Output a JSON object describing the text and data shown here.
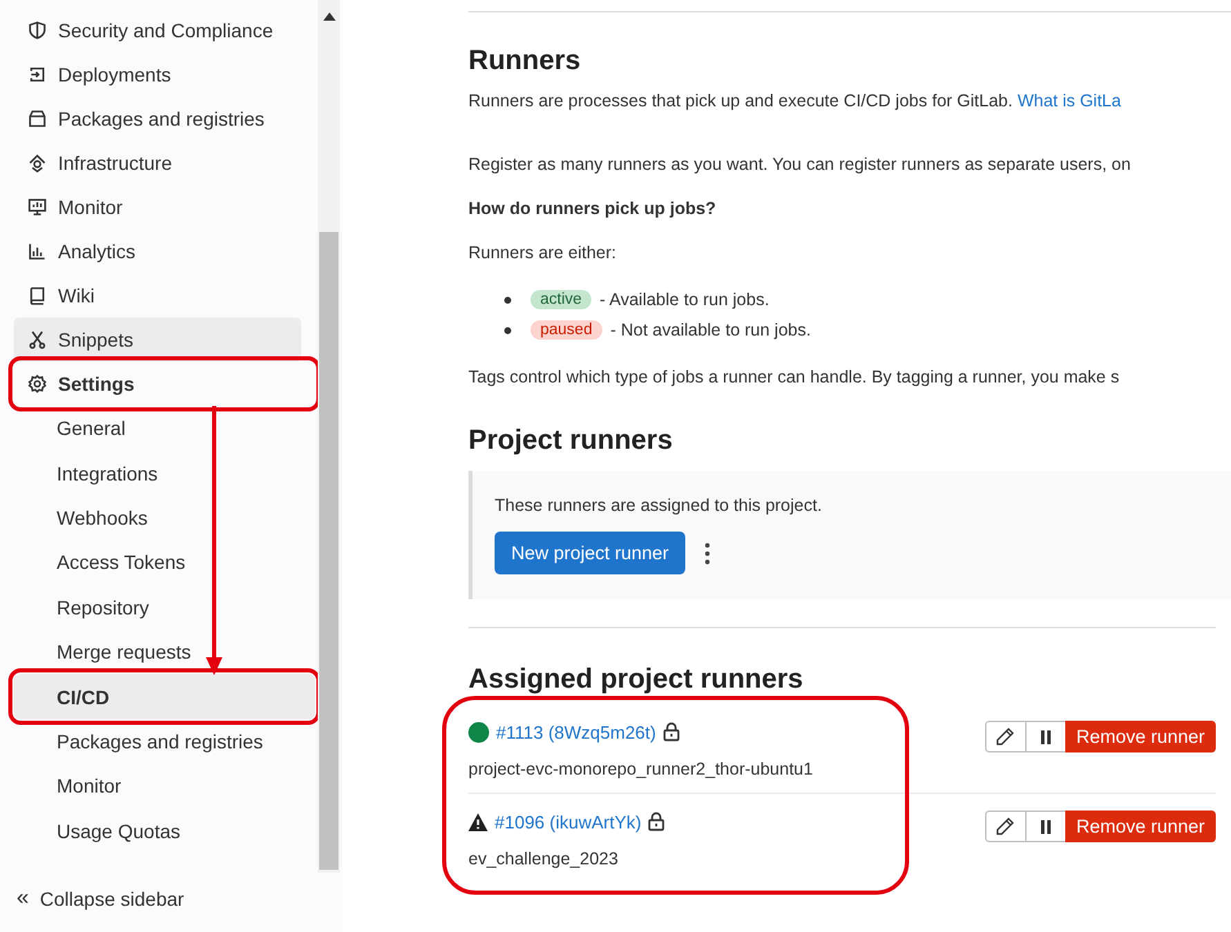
{
  "sidebar": {
    "items": [
      {
        "label": "Security and Compliance",
        "hovered": false,
        "highlighted": false
      },
      {
        "label": "Deployments",
        "hovered": false,
        "highlighted": false
      },
      {
        "label": "Packages and registries",
        "hovered": false,
        "highlighted": false
      },
      {
        "label": "Infrastructure",
        "hovered": false,
        "highlighted": false
      },
      {
        "label": "Monitor",
        "hovered": false,
        "highlighted": false
      },
      {
        "label": "Analytics",
        "hovered": false,
        "highlighted": false
      },
      {
        "label": "Wiki",
        "hovered": false,
        "highlighted": false
      },
      {
        "label": "Snippets",
        "hovered": true,
        "highlighted": false
      },
      {
        "label": "Settings",
        "hovered": false,
        "highlighted": true,
        "expanded": true,
        "children": [
          {
            "label": "General",
            "selected": false,
            "highlighted": false
          },
          {
            "label": "Integrations",
            "selected": false,
            "highlighted": false
          },
          {
            "label": "Webhooks",
            "selected": false,
            "highlighted": false
          },
          {
            "label": "Access Tokens",
            "selected": false,
            "highlighted": false
          },
          {
            "label": "Repository",
            "selected": false,
            "highlighted": false
          },
          {
            "label": "Merge requests",
            "selected": false,
            "highlighted": false
          },
          {
            "label": "CI/CD",
            "selected": true,
            "highlighted": true
          },
          {
            "label": "Packages and registries",
            "selected": false,
            "highlighted": false
          },
          {
            "label": "Monitor",
            "selected": false,
            "highlighted": false
          },
          {
            "label": "Usage Quotas",
            "selected": false,
            "highlighted": false
          }
        ]
      }
    ],
    "collapse": {
      "icon": "«",
      "label": "Collapse sidebar"
    }
  },
  "runners": {
    "title": "Runners",
    "intro": "Runners are processes that pick up and execute CI/CD jobs for GitLab.",
    "intro_link": "What is GitLa",
    "register": "Register as many runners as you want. You can register runners as separate users, on",
    "question": "How do runners pick up jobs?",
    "either": "Runners are either:",
    "states": [
      {
        "kind": "active",
        "badge": "active",
        "text": "- Available to run jobs."
      },
      {
        "kind": "paused",
        "badge": "paused",
        "text": "- Not available to run jobs."
      }
    ],
    "tags": "Tags control which type of jobs a runner can handle. By tagging a runner, you make s"
  },
  "project_runners": {
    "title": "Project runners",
    "note": "These runners are assigned to this project.",
    "button": "New project runner"
  },
  "assigned": {
    "title": "Assigned project runners",
    "highlighted": true,
    "runners": [
      {
        "kind": "online",
        "id": "#1113 (8Wzq5m26t)",
        "locked": true,
        "name": "project-evc-monorepo_runner2_thor-ubuntu1",
        "remove": "Remove runner"
      },
      {
        "kind": "stale",
        "id": "#1096 (ikuwArtYk)",
        "locked": true,
        "name": "ev_challenge_2023",
        "remove": "Remove runner"
      }
    ]
  }
}
